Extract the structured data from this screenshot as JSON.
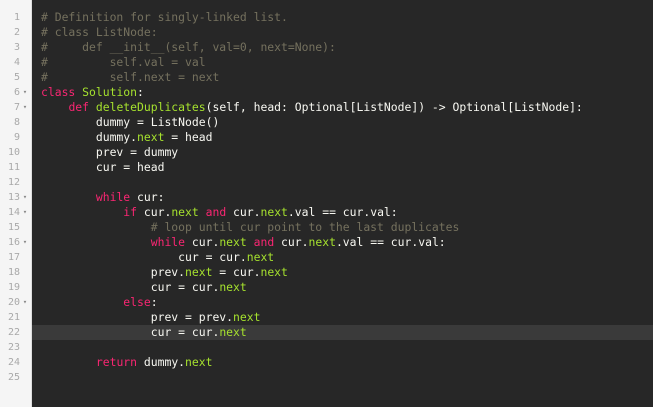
{
  "editor": {
    "lines": [
      {
        "num": "1",
        "fold": false,
        "tokens": [
          {
            "t": "# Definition for singly-linked list.",
            "c": "comment"
          }
        ]
      },
      {
        "num": "2",
        "fold": false,
        "tokens": [
          {
            "t": "# class ListNode:",
            "c": "comment"
          }
        ]
      },
      {
        "num": "3",
        "fold": false,
        "tokens": [
          {
            "t": "#     def __init__(self, val=0, next=None):",
            "c": "comment"
          }
        ]
      },
      {
        "num": "4",
        "fold": false,
        "tokens": [
          {
            "t": "#         self.val = val",
            "c": "comment"
          }
        ]
      },
      {
        "num": "5",
        "fold": false,
        "tokens": [
          {
            "t": "#         self.next = next",
            "c": "comment"
          }
        ]
      },
      {
        "num": "6",
        "fold": true,
        "tokens": [
          {
            "t": "class ",
            "c": "keyword"
          },
          {
            "t": "Solution",
            "c": "name"
          },
          {
            "t": ":",
            "c": "plain"
          }
        ]
      },
      {
        "num": "7",
        "fold": true,
        "tokens": [
          {
            "t": "    ",
            "c": "plain"
          },
          {
            "t": "def ",
            "c": "keyword"
          },
          {
            "t": "deleteDuplicates",
            "c": "name"
          },
          {
            "t": "(self, head: Optional[ListNode]) -> Optional[ListNode]:",
            "c": "plain"
          }
        ]
      },
      {
        "num": "8",
        "fold": false,
        "tokens": [
          {
            "t": "        dummy = ListNode()",
            "c": "plain"
          }
        ]
      },
      {
        "num": "9",
        "fold": false,
        "tokens": [
          {
            "t": "        dummy.",
            "c": "plain"
          },
          {
            "t": "next",
            "c": "prop"
          },
          {
            "t": " = head",
            "c": "plain"
          }
        ]
      },
      {
        "num": "10",
        "fold": false,
        "tokens": [
          {
            "t": "        prev = dummy",
            "c": "plain"
          }
        ]
      },
      {
        "num": "11",
        "fold": false,
        "tokens": [
          {
            "t": "        cur = head",
            "c": "plain"
          }
        ]
      },
      {
        "num": "12",
        "fold": false,
        "tokens": []
      },
      {
        "num": "13",
        "fold": true,
        "tokens": [
          {
            "t": "        ",
            "c": "plain"
          },
          {
            "t": "while",
            "c": "keyword"
          },
          {
            "t": " cur:",
            "c": "plain"
          }
        ]
      },
      {
        "num": "14",
        "fold": true,
        "tokens": [
          {
            "t": "            ",
            "c": "plain"
          },
          {
            "t": "if",
            "c": "keyword"
          },
          {
            "t": " cur.",
            "c": "plain"
          },
          {
            "t": "next",
            "c": "prop"
          },
          {
            "t": " ",
            "c": "plain"
          },
          {
            "t": "and",
            "c": "keyword"
          },
          {
            "t": " cur.",
            "c": "plain"
          },
          {
            "t": "next",
            "c": "prop"
          },
          {
            "t": ".val == cur.val:",
            "c": "plain"
          }
        ]
      },
      {
        "num": "15",
        "fold": false,
        "tokens": [
          {
            "t": "                # loop until cur point to the last duplicates",
            "c": "comment"
          }
        ]
      },
      {
        "num": "16",
        "fold": true,
        "tokens": [
          {
            "t": "                ",
            "c": "plain"
          },
          {
            "t": "while",
            "c": "keyword"
          },
          {
            "t": " cur.",
            "c": "plain"
          },
          {
            "t": "next",
            "c": "prop"
          },
          {
            "t": " ",
            "c": "plain"
          },
          {
            "t": "and",
            "c": "keyword"
          },
          {
            "t": " cur.",
            "c": "plain"
          },
          {
            "t": "next",
            "c": "prop"
          },
          {
            "t": ".val == cur.val:",
            "c": "plain"
          }
        ]
      },
      {
        "num": "17",
        "fold": false,
        "tokens": [
          {
            "t": "                    cur = cur.",
            "c": "plain"
          },
          {
            "t": "next",
            "c": "prop"
          }
        ]
      },
      {
        "num": "18",
        "fold": false,
        "tokens": [
          {
            "t": "                prev.",
            "c": "plain"
          },
          {
            "t": "next",
            "c": "prop"
          },
          {
            "t": " = cur.",
            "c": "plain"
          },
          {
            "t": "next",
            "c": "prop"
          }
        ]
      },
      {
        "num": "19",
        "fold": false,
        "tokens": [
          {
            "t": "                cur = cur.",
            "c": "plain"
          },
          {
            "t": "next",
            "c": "prop"
          }
        ]
      },
      {
        "num": "20",
        "fold": true,
        "tokens": [
          {
            "t": "            ",
            "c": "plain"
          },
          {
            "t": "else",
            "c": "keyword"
          },
          {
            "t": ":",
            "c": "plain"
          }
        ]
      },
      {
        "num": "21",
        "fold": false,
        "tokens": [
          {
            "t": "                prev = prev.",
            "c": "plain"
          },
          {
            "t": "next",
            "c": "prop"
          }
        ]
      },
      {
        "num": "22",
        "fold": false,
        "active": true,
        "tokens": [
          {
            "t": "                cur = cur.",
            "c": "plain"
          },
          {
            "t": "next",
            "c": "prop"
          }
        ]
      },
      {
        "num": "23",
        "fold": false,
        "tokens": []
      },
      {
        "num": "24",
        "fold": false,
        "tokens": [
          {
            "t": "        ",
            "c": "plain"
          },
          {
            "t": "return",
            "c": "keyword"
          },
          {
            "t": " dummy.",
            "c": "plain"
          },
          {
            "t": "next",
            "c": "prop"
          }
        ]
      },
      {
        "num": "25",
        "fold": false,
        "tokens": []
      }
    ],
    "fold_icon": "fold-arrow-icon",
    "colors": {
      "background": "#272727",
      "gutter": "#f5f5f5",
      "comment": "#75715e",
      "keyword": "#f92672",
      "name": "#a6e22e",
      "text": "#f8f8f2",
      "active_line": "#3a3a3a"
    }
  }
}
